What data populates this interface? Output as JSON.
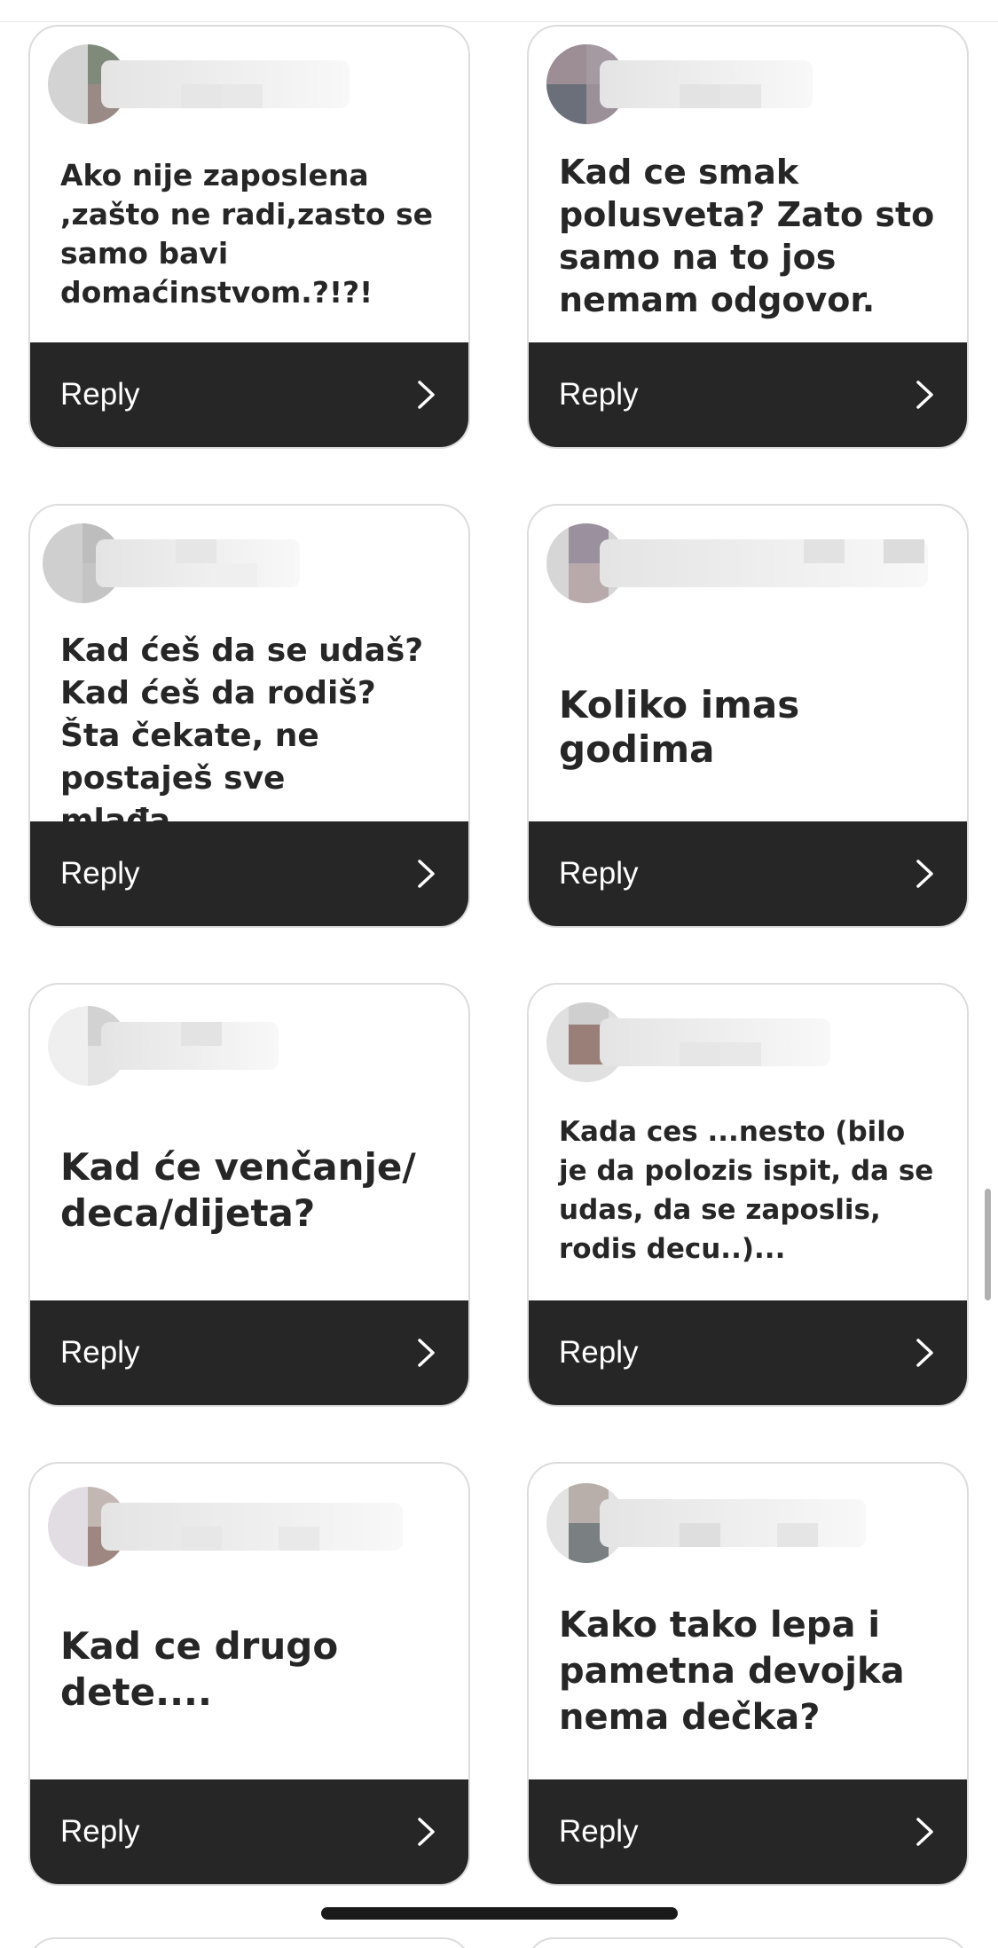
{
  "reply_label": "Reply",
  "colors": {
    "reply_bar": "#262626",
    "card_border": "#dcdcdc",
    "question_text": "#262626"
  },
  "icons": {
    "reply_chevron": "chevron-right-icon"
  },
  "questions": [
    "Ako nije zaposlena ,zašto ne radi,zasto se samo bavi domaćinstvom.?!?!",
    "Kad ce smak polusveta? Zato sto samo na to jos nemam odgovor.",
    "Kad ćeš da se udaš? Kad ćeš da rodiš? Šta čekate, ne postaješ sve mlađa...",
    "Koliko imas godima",
    "Kad će venčanje/ deca/dijeta?",
    "Kada ces ...nesto (bilo je da polozis ispit, da se udas, da se zaposlis, rodis decu..)...",
    "Kad ce drugo dete....",
    "Kako tako lepa i pametna devojka nema dečka?"
  ]
}
